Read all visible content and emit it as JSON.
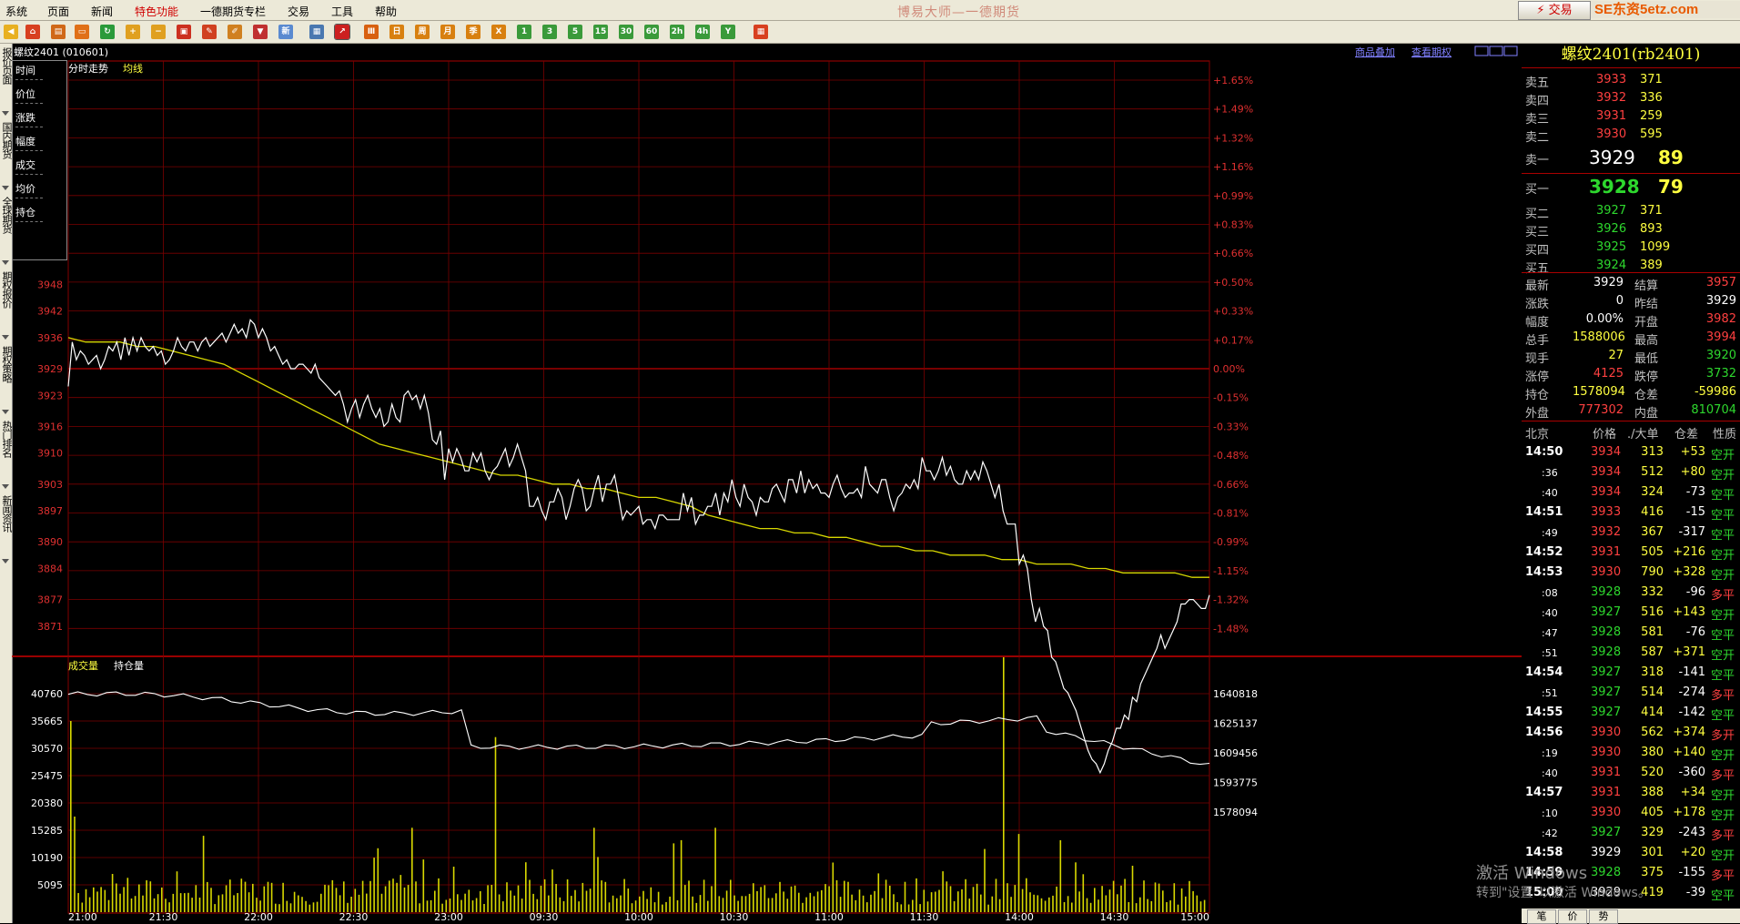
{
  "menu": [
    "系统",
    "页面",
    "新闻",
    "特色功能",
    "一德期货专栏",
    "交易",
    "工具",
    "帮助"
  ],
  "app_title": "博易大师—一德期货",
  "trade_button": "⚡ 交易",
  "watermark_logo": "SE东资5etz.com",
  "toolbar_numbers": [
    "1",
    "3",
    "5",
    "15",
    "30",
    "60",
    "2h",
    "4h",
    "Y"
  ],
  "left_tabs": [
    "报价页面",
    "国内期货",
    "全球期货",
    "期权报价",
    "期权策略",
    "热门排名",
    "新闻资讯"
  ],
  "chart": {
    "contract_label": "螺纹2401 (010601)",
    "link_overlay": "商品叠加",
    "link_option": "查看期权",
    "legend_time_trend": "分时走势",
    "legend_avg": "均线",
    "legend_volume": "成交量",
    "legend_open_interest": "持仓量",
    "price_ticks": [
      "3948",
      "3942",
      "3936",
      "3929",
      "3923",
      "3916",
      "3910",
      "3903",
      "3897",
      "3890",
      "3884",
      "3877",
      "3871"
    ],
    "pct_ticks": [
      "+1.65%",
      "+1.49%",
      "+1.32%",
      "+1.16%",
      "+0.99%",
      "+0.83%",
      "+0.66%",
      "+0.50%",
      "+0.33%",
      "+0.17%",
      "0.00%",
      "-0.15%",
      "-0.33%",
      "-0.48%",
      "-0.66%",
      "-0.81%",
      "-0.99%",
      "-1.15%",
      "-1.32%",
      "-1.48%"
    ],
    "vol_ticks": [
      "40760",
      "35665",
      "30570",
      "25475",
      "20380",
      "15285",
      "10190",
      "5095"
    ],
    "oi_ticks": [
      "1640818",
      "1625137",
      "1609456",
      "1593775",
      "1578094"
    ],
    "time_ticks": [
      "21:00",
      "21:30",
      "22:00",
      "22:30",
      "23:00",
      "09:30",
      "10:00",
      "10:30",
      "11:00",
      "11:30",
      "14:00",
      "14:30",
      "15:00"
    ],
    "colors": {
      "price": "#ffffff",
      "avg": "#d8d800",
      "volume": "#d8d800",
      "oi": "#ffffff",
      "grid": "#8b0000",
      "axis": "#e03030"
    }
  },
  "chart_data": {
    "type": "line",
    "price_series": [
      3925,
      3935,
      3931,
      3933,
      3932,
      3930,
      3931,
      3932,
      3929,
      3931,
      3934,
      3933,
      3935,
      3931,
      3936,
      3932,
      3936,
      3933,
      3936,
      3934,
      3933,
      3934,
      3932,
      3933,
      3930,
      3931,
      3933,
      3936,
      3934,
      3933,
      3935,
      3935,
      3933,
      3935,
      3936,
      3934,
      3935,
      3936,
      3937,
      3935,
      3937,
      3939,
      3937,
      3938,
      3936,
      3940,
      3939,
      3936,
      3938,
      3936,
      3933,
      3934,
      3932,
      3930,
      3931,
      3929,
      3929,
      3930,
      3930,
      3929,
      3928,
      3930,
      3927,
      3926,
      3925,
      3924,
      3923,
      3924,
      3921,
      3917,
      3920,
      3922,
      3918,
      3921,
      3923,
      3920,
      3918,
      3920,
      3916,
      3917,
      3921,
      3918,
      3917,
      3923,
      3924,
      3922,
      3923,
      3920,
      3923,
      3919,
      3913,
      3912,
      3915,
      3904,
      3911,
      3908,
      3911,
      3909,
      3906,
      3906,
      3910,
      3908,
      3910,
      3906,
      3904,
      3906,
      3907,
      3909,
      3911,
      3907,
      3909,
      3912,
      3909,
      3906,
      3898,
      3898,
      3900,
      3897,
      3895,
      3899,
      3899,
      3902,
      3900,
      3895,
      3898,
      3902,
      3904,
      3902,
      3897,
      3898,
      3902,
      3905,
      3899,
      3903,
      3903,
      3905,
      3900,
      3895,
      3897,
      3896,
      3897,
      3898,
      3894,
      3895,
      3895,
      3893,
      3896,
      3896,
      3895,
      3895,
      3895,
      3895,
      3901,
      3897,
      3900,
      3894,
      3896,
      3896,
      3898,
      3898,
      3901,
      3896,
      3901,
      3899,
      3904,
      3900,
      3898,
      3903,
      3900,
      3899,
      3896,
      3900,
      3899,
      3899,
      3902,
      3903,
      3901,
      3899,
      3904,
      3904,
      3901,
      3906,
      3901,
      3904,
      3902,
      3903,
      3901,
      3901,
      3900,
      3903,
      3905,
      3902,
      3900,
      3901,
      3901,
      3902,
      3900,
      3907,
      3903,
      3902,
      3901,
      3904,
      3904,
      3900,
      3897,
      3900,
      3901,
      3903,
      3902,
      3904,
      3902,
      3909,
      3906,
      3906,
      3904,
      3906,
      3909,
      3905,
      3907,
      3904,
      3903,
      3903,
      3906,
      3904,
      3906,
      3904,
      3908,
      3906,
      3903,
      3900,
      3903,
      3897,
      3894,
      3894,
      3894,
      3885,
      3887,
      3884,
      3877,
      3872,
      3875,
      3871,
      3870,
      3864,
      3863,
      3860,
      3857,
      3856,
      3854,
      3852,
      3849,
      3846,
      3843,
      3841,
      3840,
      3838,
      3840,
      3843,
      3845,
      3848,
      3848,
      3851,
      3850,
      3855,
      3854,
      3858,
      3860,
      3862,
      3864,
      3866,
      3869,
      3866,
      3868,
      3870,
      3872,
      3876,
      3876,
      3877,
      3877,
      3876,
      3875,
      3875,
      3878
    ],
    "avg_series": [
      3936,
      3935,
      3935,
      3935,
      3934,
      3934,
      3933,
      3932,
      3931,
      3930,
      3928,
      3926,
      3924,
      3922,
      3920,
      3918,
      3916,
      3914,
      3912,
      3911,
      3910,
      3909,
      3908,
      3907,
      3906,
      3905,
      3905,
      3904,
      3903,
      3903,
      3902,
      3902,
      3901,
      3900,
      3900,
      3899,
      3898,
      3896,
      3895,
      3894,
      3893,
      3893,
      3892,
      3892,
      3891,
      3891,
      3890,
      3889,
      3889,
      3888,
      3888,
      3887,
      3887,
      3887,
      3886,
      3886,
      3885,
      3885,
      3885,
      3884,
      3884,
      3883,
      3883,
      3883,
      3883,
      3882,
      3882
    ],
    "volume_max": 40760,
    "open_interest_range": [
      1578094,
      1640818
    ],
    "summary": "螺纹2401 intraday time-share chart, 21:00 to 15:00 session, price range 3871-3948"
  },
  "quote": {
    "title": "螺纹2401(rb2401)",
    "asks": [
      {
        "label": "卖五",
        "price": "3933",
        "vol": "371"
      },
      {
        "label": "卖四",
        "price": "3932",
        "vol": "336"
      },
      {
        "label": "卖三",
        "price": "3931",
        "vol": "259"
      },
      {
        "label": "卖二",
        "price": "3930",
        "vol": "595"
      }
    ],
    "ask1": {
      "label": "卖一",
      "price": "3929",
      "vol": "89"
    },
    "bid1": {
      "label": "买一",
      "price": "3928",
      "vol": "79"
    },
    "bids": [
      {
        "label": "买二",
        "price": "3927",
        "vol": "371"
      },
      {
        "label": "买三",
        "price": "3926",
        "vol": "893"
      },
      {
        "label": "买四",
        "price": "3925",
        "vol": "1099"
      },
      {
        "label": "买五",
        "price": "3924",
        "vol": "389"
      }
    ],
    "stats": [
      {
        "l1": "最新",
        "v1": "3929",
        "c1": "white",
        "l2": "结算",
        "v2": "3957",
        "c2": "red"
      },
      {
        "l1": "涨跌",
        "v1": "0",
        "c1": "white",
        "l2": "昨结",
        "v2": "3929",
        "c2": "white"
      },
      {
        "l1": "幅度",
        "v1": "0.00%",
        "c1": "white",
        "l2": "开盘",
        "v2": "3982",
        "c2": "red"
      },
      {
        "l1": "总手",
        "v1": "1588006",
        "c1": "yellow",
        "l2": "最高",
        "v2": "3994",
        "c2": "red"
      },
      {
        "l1": "现手",
        "v1": "27",
        "c1": "yellow",
        "l2": "最低",
        "v2": "3920",
        "c2": "green"
      },
      {
        "l1": "涨停",
        "v1": "4125",
        "c1": "red",
        "l2": "跌停",
        "v2": "3732",
        "c2": "green"
      },
      {
        "l1": "持仓",
        "v1": "1578094",
        "c1": "yellow",
        "l2": "仓差",
        "v2": "-59986",
        "c2": "yellow"
      },
      {
        "l1": "外盘",
        "v1": "777302",
        "c1": "red",
        "l2": "内盘",
        "v2": "810704",
        "c2": "green"
      }
    ],
    "trade_headers": [
      "北京",
      "价格",
      "./大单",
      "仓差",
      "性质"
    ],
    "trades": [
      {
        "time": "14:50",
        "minor": false,
        "price": "3934",
        "pc": "red",
        "vol": "313",
        "diff": "+53",
        "nat": "空开"
      },
      {
        "time": ":36",
        "minor": true,
        "price": "3934",
        "pc": "red",
        "vol": "512",
        "diff": "+80",
        "nat": "空开"
      },
      {
        "time": ":40",
        "minor": true,
        "price": "3934",
        "pc": "red",
        "vol": "324",
        "diff": "-73",
        "nat": "空平"
      },
      {
        "time": "14:51",
        "minor": false,
        "price": "3933",
        "pc": "red",
        "vol": "416",
        "diff": "-15",
        "nat": "空平"
      },
      {
        "time": ":49",
        "minor": true,
        "price": "3932",
        "pc": "red",
        "vol": "367",
        "diff": "-317",
        "nat": "空平"
      },
      {
        "time": "14:52",
        "minor": false,
        "price": "3931",
        "pc": "red",
        "vol": "505",
        "diff": "+216",
        "nat": "空开"
      },
      {
        "time": "14:53",
        "minor": false,
        "price": "3930",
        "pc": "red",
        "vol": "790",
        "diff": "+328",
        "nat": "空开"
      },
      {
        "time": ":08",
        "minor": true,
        "price": "3928",
        "pc": "green",
        "vol": "332",
        "diff": "-96",
        "nat": "多平"
      },
      {
        "time": ":40",
        "minor": true,
        "price": "3927",
        "pc": "green",
        "vol": "516",
        "diff": "+143",
        "nat": "空开"
      },
      {
        "time": ":47",
        "minor": true,
        "price": "3928",
        "pc": "green",
        "vol": "581",
        "diff": "-76",
        "nat": "空平"
      },
      {
        "time": ":51",
        "minor": true,
        "price": "3928",
        "pc": "green",
        "vol": "587",
        "diff": "+371",
        "nat": "空开"
      },
      {
        "time": "14:54",
        "minor": false,
        "price": "3927",
        "pc": "green",
        "vol": "318",
        "diff": "-141",
        "nat": "空平"
      },
      {
        "time": ":51",
        "minor": true,
        "price": "3927",
        "pc": "green",
        "vol": "514",
        "diff": "-274",
        "nat": "多平"
      },
      {
        "time": "14:55",
        "minor": false,
        "price": "3927",
        "pc": "green",
        "vol": "414",
        "diff": "-142",
        "nat": "空平"
      },
      {
        "time": "14:56",
        "minor": false,
        "price": "3930",
        "pc": "red",
        "vol": "562",
        "diff": "+374",
        "nat": "多开"
      },
      {
        "time": ":19",
        "minor": true,
        "price": "3930",
        "pc": "red",
        "vol": "380",
        "diff": "+140",
        "nat": "空开"
      },
      {
        "time": ":40",
        "minor": true,
        "price": "3931",
        "pc": "red",
        "vol": "520",
        "diff": "-360",
        "nat": "多平"
      },
      {
        "time": "14:57",
        "minor": false,
        "price": "3931",
        "pc": "red",
        "vol": "388",
        "diff": "+34",
        "nat": "空开"
      },
      {
        "time": ":10",
        "minor": true,
        "price": "3930",
        "pc": "red",
        "vol": "405",
        "diff": "+178",
        "nat": "空开"
      },
      {
        "time": ":42",
        "minor": true,
        "price": "3927",
        "pc": "green",
        "vol": "329",
        "diff": "-243",
        "nat": "多平"
      },
      {
        "time": "14:58",
        "minor": false,
        "price": "3929",
        "pc": "white",
        "vol": "301",
        "diff": "+20",
        "nat": "空开"
      },
      {
        "time": "14:59",
        "minor": false,
        "price": "3928",
        "pc": "green",
        "vol": "375",
        "diff": "-155",
        "nat": "多平"
      },
      {
        "time": "15:00",
        "minor": false,
        "price": "3929",
        "pc": "white",
        "vol": "419",
        "diff": "-39",
        "nat": "空平"
      }
    ],
    "bottom_tabs": [
      "笔",
      "价",
      "势"
    ]
  },
  "infobox": [
    "时间",
    "价位",
    "涨跌",
    "幅度",
    "成交",
    "均价",
    "持仓"
  ],
  "windows_watermark_1": "激活 Windows",
  "windows_watermark_2": "转到\"设置\"以激活 Windows。"
}
